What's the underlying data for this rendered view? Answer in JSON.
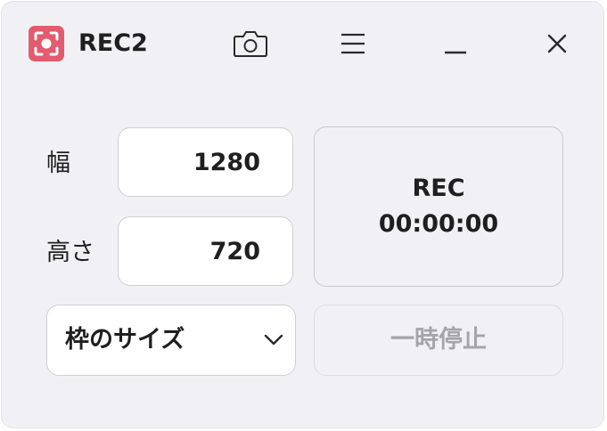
{
  "window": {
    "title": "REC2",
    "colors": {
      "accent": "#e25b6e",
      "background": "#f1f1f5",
      "disabled_text": "#a4a4aa"
    },
    "icons": {
      "app": "screen-record-icon",
      "screenshot": "camera-icon",
      "menu": "hamburger-menu-icon",
      "minimize": "minimize-icon",
      "close": "close-icon"
    }
  },
  "form": {
    "width_label": "幅",
    "width_value": "1280",
    "height_label": "高さ",
    "height_value": "720",
    "size_select_label": "枠のサイズ"
  },
  "record": {
    "label": "REC",
    "elapsed": "00:00:00",
    "pause_label": "一時停止",
    "pause_enabled": false
  }
}
